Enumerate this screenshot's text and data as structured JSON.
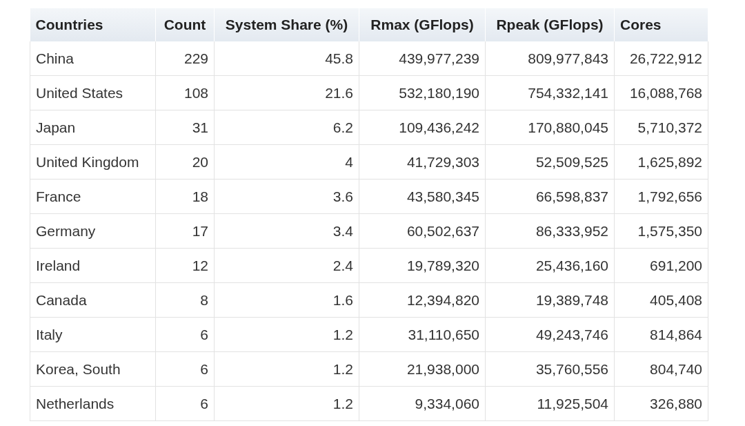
{
  "table": {
    "columns": [
      "Countries",
      "Count",
      "System Share (%)",
      "Rmax (GFlops)",
      "Rpeak (GFlops)",
      "Cores"
    ],
    "rows": [
      [
        "China",
        "229",
        "45.8",
        "439,977,239",
        "809,977,843",
        "26,722,912"
      ],
      [
        "United States",
        "108",
        "21.6",
        "532,180,190",
        "754,332,141",
        "16,088,768"
      ],
      [
        "Japan",
        "31",
        "6.2",
        "109,436,242",
        "170,880,045",
        "5,710,372"
      ],
      [
        "United Kingdom",
        "20",
        "4",
        "41,729,303",
        "52,509,525",
        "1,625,892"
      ],
      [
        "France",
        "18",
        "3.6",
        "43,580,345",
        "66,598,837",
        "1,792,656"
      ],
      [
        "Germany",
        "17",
        "3.4",
        "60,502,637",
        "86,333,952",
        "1,575,350"
      ],
      [
        "Ireland",
        "12",
        "2.4",
        "19,789,320",
        "25,436,160",
        "691,200"
      ],
      [
        "Canada",
        "8",
        "1.6",
        "12,394,820",
        "19,389,748",
        "405,408"
      ],
      [
        "Italy",
        "6",
        "1.2",
        "31,110,650",
        "49,243,746",
        "814,864"
      ],
      [
        "Korea, South",
        "6",
        "1.2",
        "21,938,000",
        "35,760,556",
        "804,740"
      ],
      [
        "Netherlands",
        "6",
        "1.2",
        "9,334,060",
        "11,925,504",
        "326,880"
      ]
    ]
  }
}
